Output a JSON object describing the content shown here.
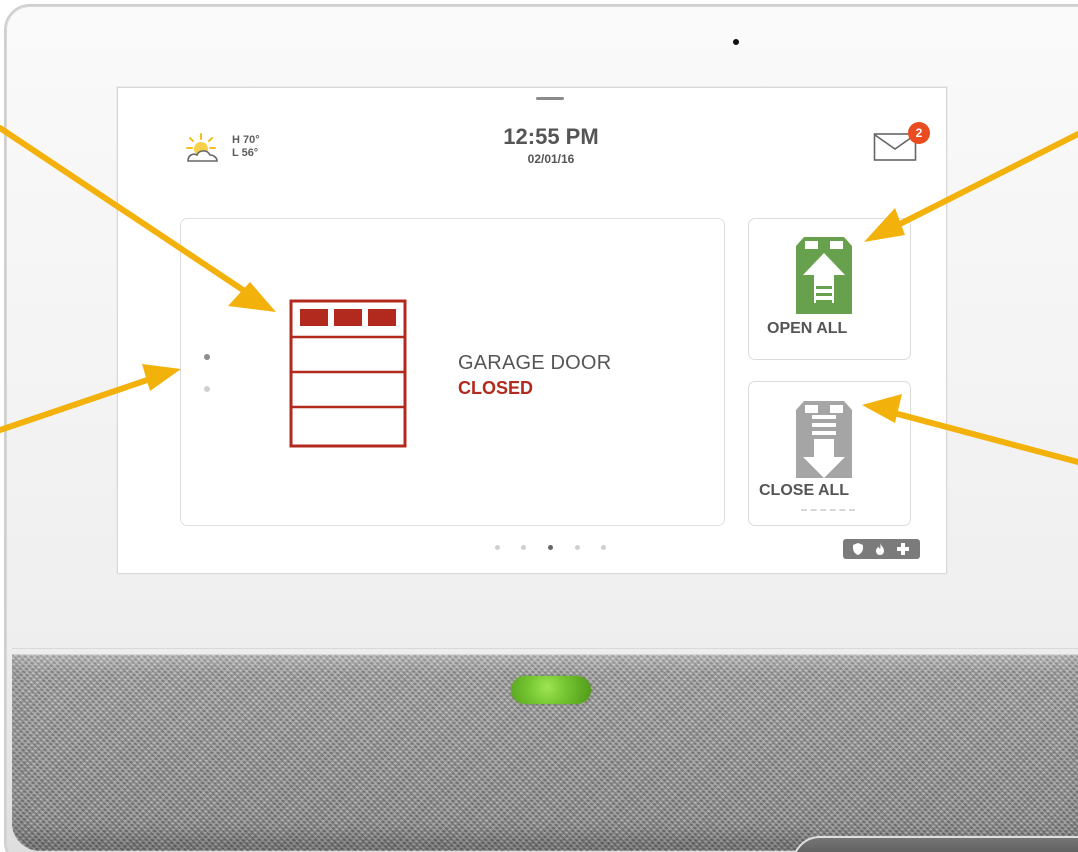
{
  "weather": {
    "high": "H 70°",
    "low": "L 56°",
    "icon": "sun-cloud-icon"
  },
  "header": {
    "time": "12:55 PM",
    "date": "02/01/16"
  },
  "messages": {
    "count": "2",
    "icon": "envelope-icon"
  },
  "device": {
    "name": "GARAGE DOOR",
    "status": "CLOSED",
    "icon": "garage-door-icon"
  },
  "actions": {
    "open_all": {
      "label": "OPEN ALL",
      "icon": "garage-open-all-icon"
    },
    "close_all": {
      "label": "CLOSE ALL",
      "icon": "garage-close-all-icon"
    }
  },
  "pagination": {
    "pages": 5,
    "active_page": 3
  },
  "security_status": {
    "icons": [
      "shield-icon",
      "fire-icon",
      "medical-cross-icon"
    ]
  },
  "colors": {
    "accent_green": "#76c733",
    "status_red": "#b2291d",
    "badge_orange": "#e94c1f",
    "callout_orange": "#f3b20b",
    "open_green": "#68a14d",
    "close_gray": "#a5a5a5"
  }
}
